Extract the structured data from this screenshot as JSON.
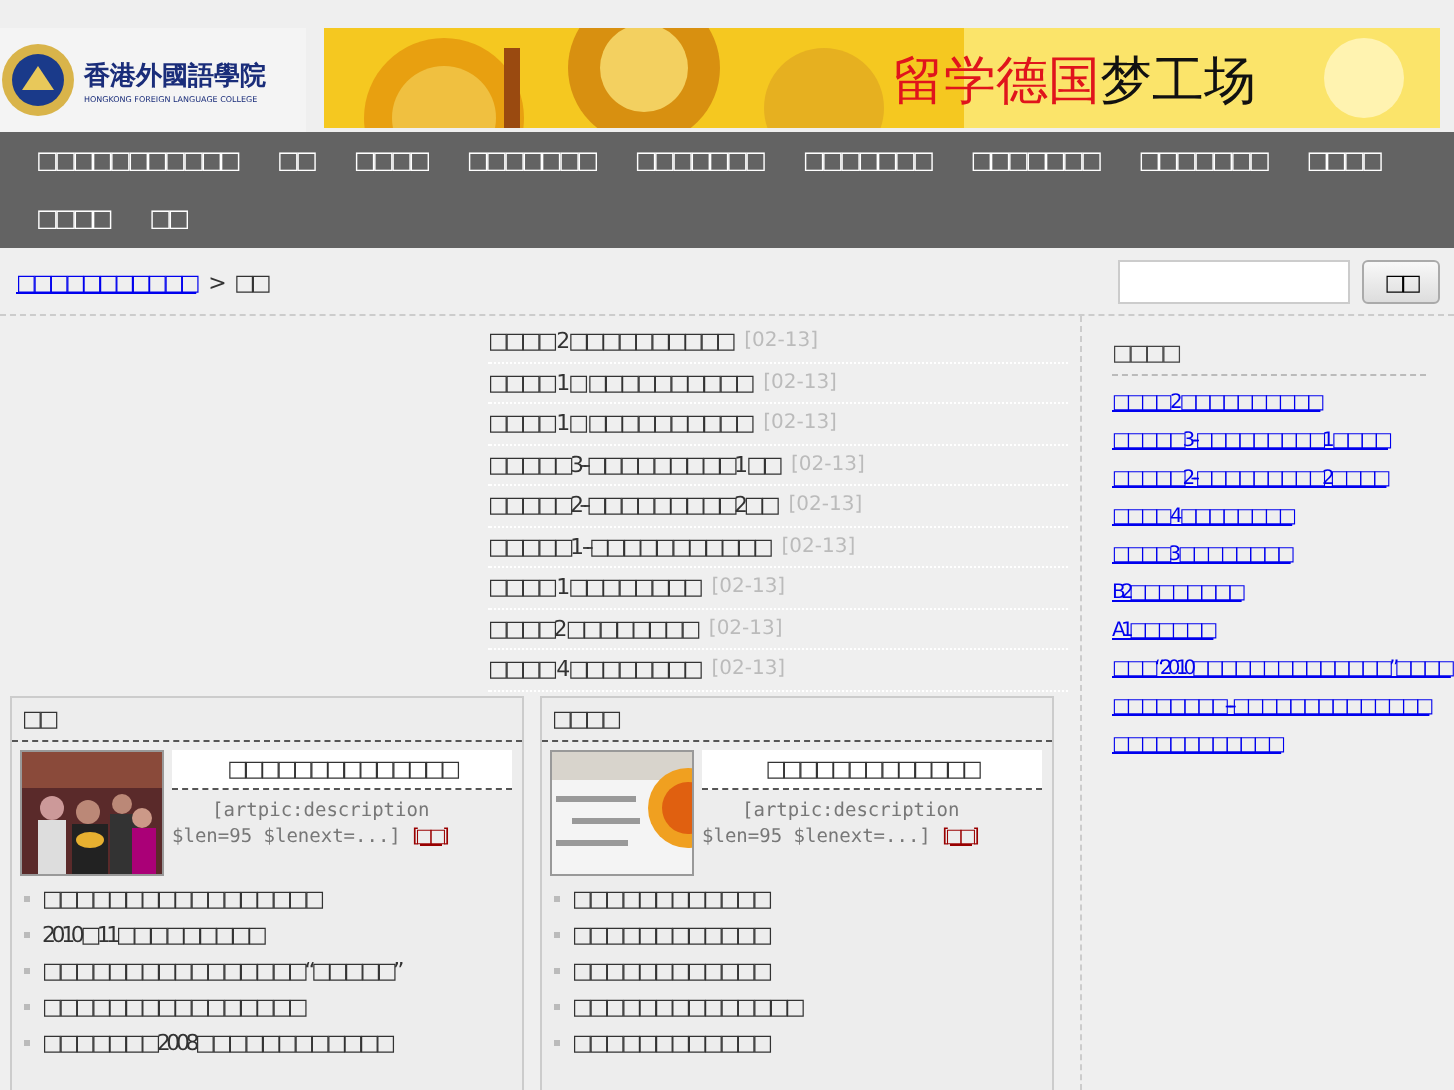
{
  "header": {
    "logo": {
      "name": "香港外國語學院",
      "subtitle": "HONGKONG FOREIGN LANGUAGE COLLEGE"
    },
    "banner": {
      "highlight": "留学德国",
      "rest": "梦工场"
    }
  },
  "nav": [
    {
      "label": "□□□□□□□□□□□"
    },
    {
      "label": "□□"
    },
    {
      "label": "□□□□"
    },
    {
      "label": "□□□□□□□"
    },
    {
      "label": "□□□□□□□"
    },
    {
      "label": "□□□□□□□"
    },
    {
      "label": "□□□□□□□"
    },
    {
      "label": "□□□□□□□"
    },
    {
      "label": "□□□□"
    },
    {
      "label": "□□□□"
    },
    {
      "label": "□□"
    }
  ],
  "breadcrumb": {
    "link": "□□□□□□□□□□□",
    "separator": ">",
    "current": "□□"
  },
  "search": {
    "button": "□□"
  },
  "articles": [
    {
      "title": "□□□□ 2 □□□□□□□□□□",
      "date": "[02-13]"
    },
    {
      "title": "□□□□ 1 □ □□□□□□□□□□",
      "date": "[02-13]"
    },
    {
      "title": "□□□□ 1 □ □□□□□□□□□□",
      "date": "[02-13]"
    },
    {
      "title": "□□□□□3--□□□□□□□□□1 □□",
      "date": "[02-13]"
    },
    {
      "title": "□□□□□2--□□□□□□□□□2□□",
      "date": "[02-13]"
    },
    {
      "title": "□□□□□1 --□□□□□□□□□□□",
      "date": "[02-13]"
    },
    {
      "title": "□□□□ 1 □□□□□□□□",
      "date": "[02-13]"
    },
    {
      "title": "□□□□2 □□□□□□□□",
      "date": "[02-13]"
    },
    {
      "title": "□□□□ 4 □□□□□□□□",
      "date": "[02-13]"
    }
  ],
  "panels": [
    {
      "title": "□□",
      "kind": "picture",
      "feature_title": "□□□□□□□□□□□□□□",
      "description": "[artpic:description $len=95 $lenext=...]",
      "more": "[□□]",
      "items": [
        "□□□□□□□□□□□□□□□□□",
        "2010□11□□□□□□□□□",
        "□□□□□□□□□□□□□□□□“□□□□□”",
        "□□□□□□□□□□□□□□□□",
        "□□□□□□□2008□□□□□□□□□□□□"
      ]
    },
    {
      "title": "□□□□",
      "kind": "picture",
      "feature_title": "□□□□□□□□□□□□□",
      "description": "[artpic:description $len=95 $lenext=...]",
      "more": "[□□]",
      "items": [
        "□□□□□□□□□□□□",
        "□□□□□□□□□□□□",
        "□□□□□□□□□□□□",
        "□□□□□□□□□□□□□□",
        "□□□□□□□□□□□□"
      ]
    }
  ],
  "sidebar": {
    "title": "□□□□",
    "links": [
      "□□□□ 2 □□□□□□□□□□",
      "□□□□□3--□□□□□□□□□1 □□□□",
      "□□□□□2--□□□□□□□□□2□□□□",
      "□□□□ 4 □□□□□□□□",
      "□□□□3 □□□□□□□□",
      "B2□□□□□□□□",
      "A1□□□□□□",
      "□□□“2010□□□□□□□□□□□□□□”□□□□",
      "□□□□□□□□---□□□□□□□□□□□□□□",
      "□□□□□□□□□□□□"
    ]
  }
}
